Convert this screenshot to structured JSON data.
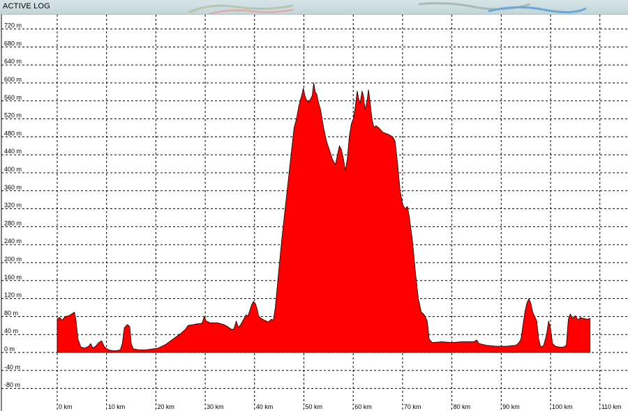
{
  "window": {
    "title": "ACTIVE LOG"
  },
  "chart_data": {
    "type": "area",
    "title": "",
    "xlabel": "",
    "ylabel": "",
    "xlim": [
      0,
      110
    ],
    "ylim": [
      -100,
      740
    ],
    "grid": true,
    "fill_color": "#ff0000",
    "stroke_color": "#000000",
    "x_ticks": [
      {
        "value": 0,
        "label": "0 km"
      },
      {
        "value": 10,
        "label": "10 km"
      },
      {
        "value": 20,
        "label": "20 km"
      },
      {
        "value": 30,
        "label": "30 km"
      },
      {
        "value": 40,
        "label": "40 km"
      },
      {
        "value": 50,
        "label": "50 km"
      },
      {
        "value": 60,
        "label": "60 km"
      },
      {
        "value": 70,
        "label": "70 km"
      },
      {
        "value": 80,
        "label": "80 km"
      },
      {
        "value": 90,
        "label": "90 km"
      },
      {
        "value": 100,
        "label": "100 km"
      },
      {
        "value": 110,
        "label": "110 km"
      }
    ],
    "y_ticks": [
      {
        "value": 720,
        "label": "720 m"
      },
      {
        "value": 680,
        "label": "680 m"
      },
      {
        "value": 640,
        "label": "640 m"
      },
      {
        "value": 600,
        "label": "600 m"
      },
      {
        "value": 560,
        "label": "560 m"
      },
      {
        "value": 520,
        "label": "520 m"
      },
      {
        "value": 480,
        "label": "480 m"
      },
      {
        "value": 440,
        "label": "440 m"
      },
      {
        "value": 400,
        "label": "400 m"
      },
      {
        "value": 360,
        "label": "360 m"
      },
      {
        "value": 320,
        "label": "320 m"
      },
      {
        "value": 280,
        "label": "280 m"
      },
      {
        "value": 240,
        "label": "240 m"
      },
      {
        "value": 200,
        "label": "200 m"
      },
      {
        "value": 160,
        "label": "160 m"
      },
      {
        "value": 120,
        "label": "120 m"
      },
      {
        "value": 80,
        "label": "80 m"
      },
      {
        "value": 40,
        "label": "40 m"
      },
      {
        "value": 0,
        "label": "0 m"
      },
      {
        "value": -40,
        "label": "-40 m"
      },
      {
        "value": -80,
        "label": "-80 m"
      }
    ],
    "series": [
      {
        "points": [
          [
            0,
            0
          ],
          [
            0,
            75
          ],
          [
            0.5,
            78
          ],
          [
            1,
            72
          ],
          [
            1.6,
            80
          ],
          [
            2.4,
            82
          ],
          [
            3,
            86
          ],
          [
            3.5,
            90
          ],
          [
            3.8,
            72
          ],
          [
            4.2,
            30
          ],
          [
            4.8,
            12
          ],
          [
            5.6,
            10
          ],
          [
            6.4,
            14
          ],
          [
            6.8,
            20
          ],
          [
            7.2,
            10
          ],
          [
            7.8,
            14
          ],
          [
            8.4,
            22
          ],
          [
            9,
            26
          ],
          [
            9.6,
            12
          ],
          [
            10.4,
            6
          ],
          [
            11.2,
            4
          ],
          [
            12,
            4
          ],
          [
            12.8,
            6
          ],
          [
            13.2,
            20
          ],
          [
            13.6,
            55
          ],
          [
            14.2,
            62
          ],
          [
            14.7,
            58
          ],
          [
            15,
            20
          ],
          [
            15.4,
            8
          ],
          [
            16.5,
            6
          ],
          [
            18,
            6
          ],
          [
            19.5,
            8
          ],
          [
            20.5,
            10
          ],
          [
            22,
            18
          ],
          [
            23.5,
            30
          ],
          [
            25,
            42
          ],
          [
            26,
            52
          ],
          [
            26.5,
            60
          ],
          [
            27.5,
            62
          ],
          [
            28.5,
            64
          ],
          [
            29,
            64
          ],
          [
            29.4,
            66
          ],
          [
            29.8,
            80
          ],
          [
            30.2,
            70
          ],
          [
            31,
            66
          ],
          [
            32.5,
            66
          ],
          [
            33.8,
            62
          ],
          [
            34.5,
            58
          ],
          [
            35.2,
            52
          ],
          [
            35.8,
            52
          ],
          [
            36.3,
            70
          ],
          [
            36.7,
            56
          ],
          [
            37.2,
            62
          ],
          [
            37.8,
            74
          ],
          [
            38.3,
            84
          ],
          [
            38.6,
            80
          ],
          [
            39,
            92
          ],
          [
            39.4,
            106
          ],
          [
            39.8,
            114
          ],
          [
            40.2,
            108
          ],
          [
            40.5,
            98
          ],
          [
            40.8,
            82
          ],
          [
            41.3,
            76
          ],
          [
            42,
            72
          ],
          [
            42.8,
            68
          ],
          [
            43.4,
            74
          ],
          [
            43.8,
            72
          ],
          [
            44.2,
            100
          ],
          [
            44.8,
            170
          ],
          [
            45.5,
            250
          ],
          [
            46.2,
            320
          ],
          [
            46.8,
            380
          ],
          [
            47.4,
            440
          ],
          [
            48,
            500
          ],
          [
            48.5,
            520
          ],
          [
            49,
            550
          ],
          [
            49.5,
            570
          ],
          [
            49.9,
            588
          ],
          [
            50.2,
            572
          ],
          [
            50.6,
            560
          ],
          [
            51,
            558
          ],
          [
            51.4,
            565
          ],
          [
            51.7,
            572
          ],
          [
            52,
            600
          ],
          [
            52.3,
            580
          ],
          [
            52.6,
            575
          ],
          [
            53,
            555
          ],
          [
            53.4,
            540
          ],
          [
            54,
            500
          ],
          [
            54.6,
            470
          ],
          [
            55.2,
            450
          ],
          [
            55.8,
            430
          ],
          [
            56.4,
            418
          ],
          [
            56.8,
            440
          ],
          [
            57.2,
            460
          ],
          [
            57.6,
            452
          ],
          [
            58,
            432
          ],
          [
            58.4,
            405
          ],
          [
            58.8,
            430
          ],
          [
            59.2,
            480
          ],
          [
            59.6,
            508
          ],
          [
            60,
            520
          ],
          [
            60.4,
            545
          ],
          [
            60.8,
            582
          ],
          [
            61.1,
            565
          ],
          [
            61.4,
            555
          ],
          [
            61.8,
            582
          ],
          [
            62.1,
            570
          ],
          [
            62.4,
            540
          ],
          [
            62.8,
            560
          ],
          [
            63.1,
            585
          ],
          [
            63.4,
            560
          ],
          [
            63.8,
            520
          ],
          [
            64.2,
            500
          ],
          [
            64.6,
            505
          ],
          [
            65.2,
            500
          ],
          [
            66,
            490
          ],
          [
            67,
            486
          ],
          [
            68,
            480
          ],
          [
            68.5,
            470
          ],
          [
            69,
            420
          ],
          [
            69.5,
            360
          ],
          [
            70,
            330
          ],
          [
            70.5,
            320
          ],
          [
            71,
            325
          ],
          [
            71.4,
            300
          ],
          [
            72,
            250
          ],
          [
            72.6,
            180
          ],
          [
            73.2,
            120
          ],
          [
            73.8,
            90
          ],
          [
            74.4,
            84
          ],
          [
            75,
            70
          ],
          [
            75.4,
            30
          ],
          [
            76,
            22
          ],
          [
            78,
            24
          ],
          [
            80,
            22
          ],
          [
            82,
            24
          ],
          [
            84.5,
            24
          ],
          [
            85,
            28
          ],
          [
            85.5,
            20
          ],
          [
            87,
            16
          ],
          [
            89,
            14
          ],
          [
            91,
            14
          ],
          [
            93,
            16
          ],
          [
            93.6,
            22
          ],
          [
            94,
            30
          ],
          [
            94.4,
            60
          ],
          [
            94.8,
            90
          ],
          [
            95.2,
            110
          ],
          [
            95.6,
            120
          ],
          [
            96,
            110
          ],
          [
            96.4,
            90
          ],
          [
            96.8,
            80
          ],
          [
            97.2,
            70
          ],
          [
            97.6,
            30
          ],
          [
            98,
            12
          ],
          [
            98.6,
            16
          ],
          [
            99.2,
            40
          ],
          [
            99.6,
            70
          ],
          [
            100,
            54
          ],
          [
            100.4,
            20
          ],
          [
            101,
            14
          ],
          [
            101.8,
            12
          ],
          [
            102.6,
            12
          ],
          [
            103.2,
            16
          ],
          [
            103.6,
            74
          ],
          [
            104,
            86
          ],
          [
            104.4,
            76
          ],
          [
            105,
            82
          ],
          [
            105.6,
            72
          ],
          [
            106,
            78
          ],
          [
            106.6,
            76
          ],
          [
            107.5,
            74
          ],
          [
            108,
            76
          ],
          [
            108,
            0
          ]
        ]
      }
    ]
  }
}
